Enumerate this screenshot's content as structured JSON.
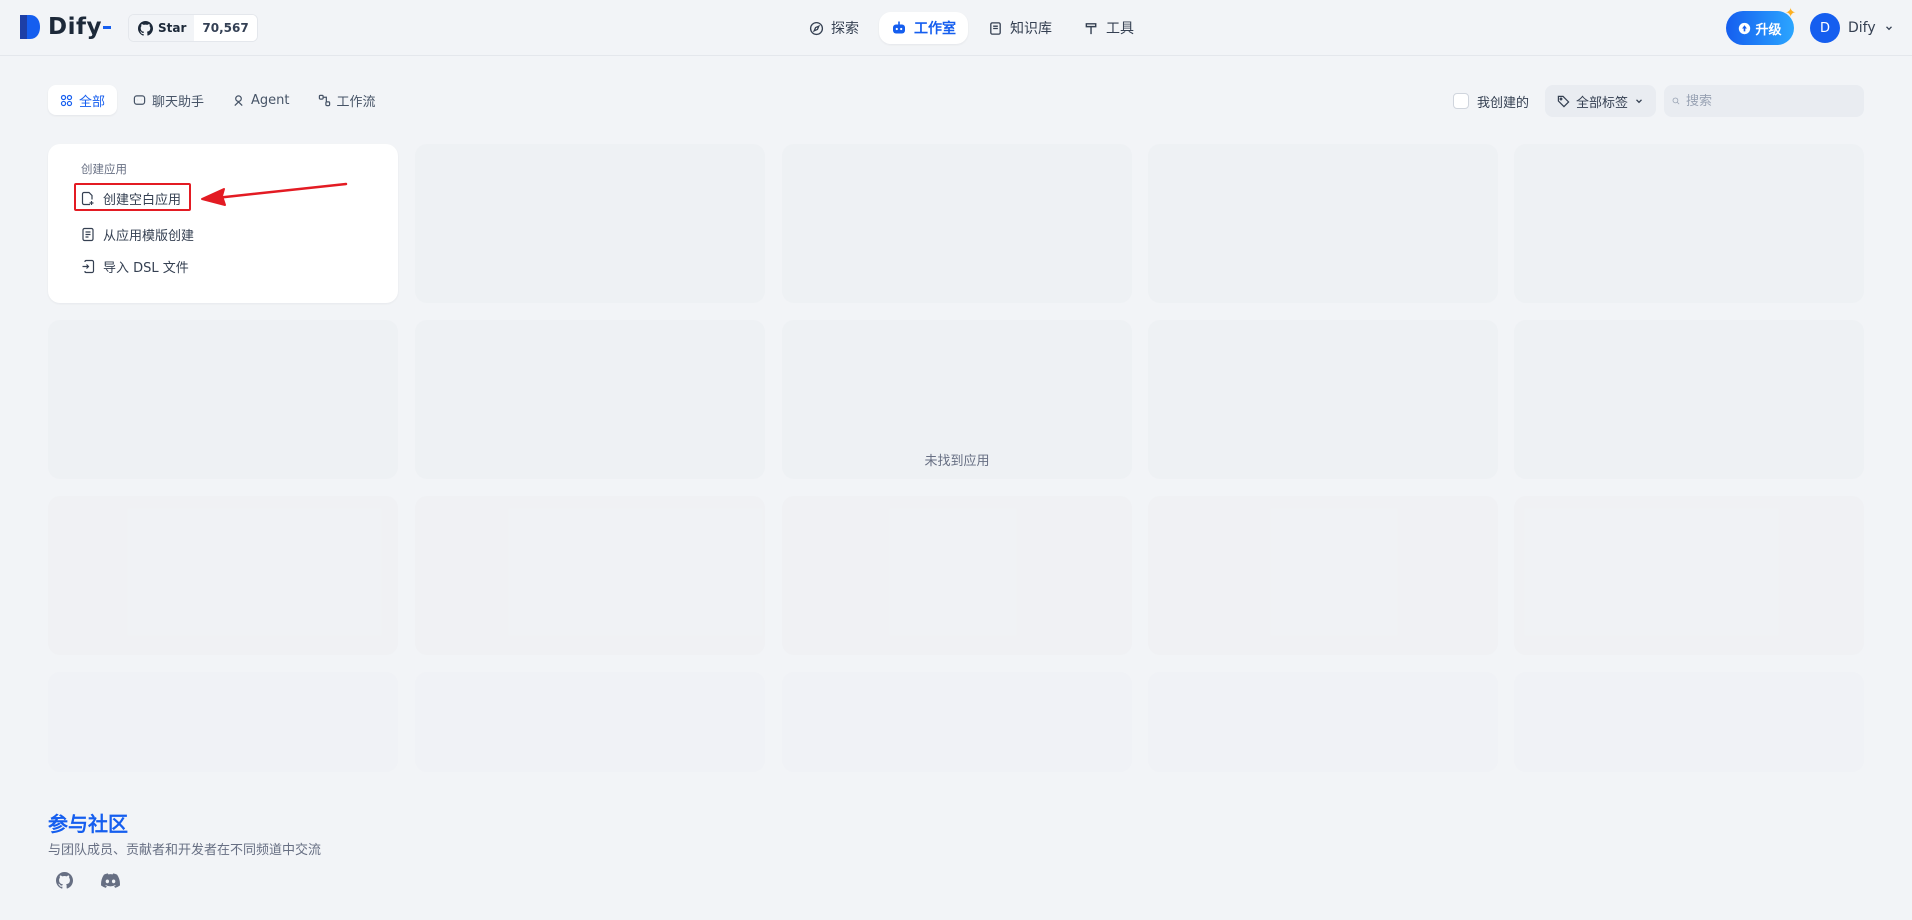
{
  "header": {
    "brand": "Dify",
    "github": {
      "label": "Star",
      "count": "70,567"
    },
    "nav": [
      {
        "label": "探索",
        "icon": "compass-icon"
      },
      {
        "label": "工作室",
        "icon": "robot-icon"
      },
      {
        "label": "知识库",
        "icon": "book-icon"
      },
      {
        "label": "工具",
        "icon": "hammer-icon"
      }
    ],
    "upgrade_label": "升级",
    "account": {
      "avatar_letter": "D",
      "name": "Dify"
    }
  },
  "tabs": [
    {
      "label": "全部",
      "active": true
    },
    {
      "label": "聊天助手"
    },
    {
      "label": "Agent"
    },
    {
      "label": "工作流"
    }
  ],
  "filters": {
    "mine_label": "我创建的",
    "tag_label": "全部标签",
    "search_placeholder": "搜索"
  },
  "create_card": {
    "title": "创建应用",
    "items": [
      {
        "label": "创建空白应用",
        "icon": "blank-file-plus-icon"
      },
      {
        "label": "从应用模版创建",
        "icon": "template-file-icon"
      },
      {
        "label": "导入 DSL 文件",
        "icon": "import-file-icon"
      }
    ]
  },
  "empty_message": "未找到应用",
  "community": {
    "title": "参与社区",
    "subtitle": "与团队成员、贡献者和开发者在不同频道中交流"
  },
  "colors": {
    "accent": "#155eef",
    "annotation_red": "#e31b23",
    "background": "#f2f4f7"
  }
}
